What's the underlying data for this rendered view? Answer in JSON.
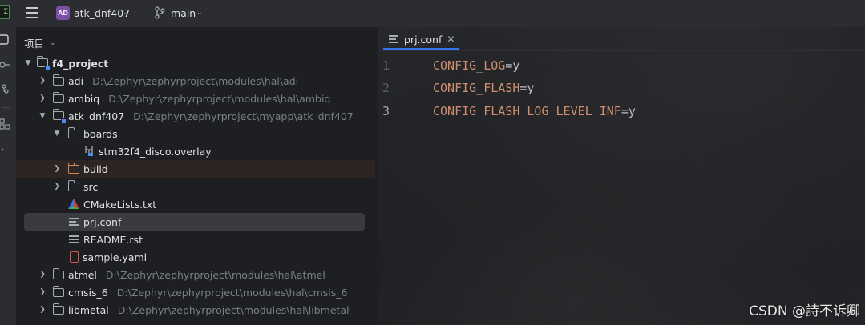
{
  "topbar": {
    "app_logo": "Σ",
    "project_badge": "AD",
    "project_name": "atk_dnf407",
    "branch": "main"
  },
  "panel": {
    "title": "项目"
  },
  "tree": {
    "root": "f4_project",
    "rows": [
      {
        "label": "adi",
        "path": "D:\\Zephyr\\zephyrproject\\modules\\hal\\adi"
      },
      {
        "label": "ambiq",
        "path": "D:\\Zephyr\\zephyrproject\\modules\\hal\\ambiq"
      },
      {
        "label": "atk_dnf407",
        "path": "D:\\Zephyr\\zephyrproject\\myapp\\atk_dnf407"
      },
      {
        "label": "boards",
        "path": ""
      },
      {
        "label": "stm32f4_disco.overlay",
        "path": ""
      },
      {
        "label": "build",
        "path": ""
      },
      {
        "label": "src",
        "path": ""
      },
      {
        "label": "CMakeLists.txt",
        "path": ""
      },
      {
        "label": "prj.conf",
        "path": ""
      },
      {
        "label": "README.rst",
        "path": ""
      },
      {
        "label": "sample.yaml",
        "path": ""
      },
      {
        "label": "atmel",
        "path": "D:\\Zephyr\\zephyrproject\\modules\\hal\\atmel"
      },
      {
        "label": "cmsis_6",
        "path": "D:\\Zephyr\\zephyrproject\\modules\\hal\\cmsis_6"
      },
      {
        "label": "libmetal",
        "path": "D:\\Zephyr\\zephyrproject\\modules\\hal\\libmetal"
      }
    ]
  },
  "editor": {
    "tab_name": "prj.conf",
    "lines": [
      {
        "num": "1",
        "key": "CONFIG_LOG",
        "eq": "=",
        "val": "y"
      },
      {
        "num": "2",
        "key": "CONFIG_FLASH",
        "eq": "=",
        "val": "y"
      },
      {
        "num": "3",
        "key": "CONFIG_FLASH_LOG_LEVEL_INF",
        "eq": "=",
        "val": "y"
      }
    ]
  },
  "watermark": "CSDN @詩不诉卿",
  "colors": {
    "accent": "#3574f0",
    "keyword": "#cf8e6d",
    "background": "#1e1f22",
    "chrome": "#2b2d30"
  }
}
